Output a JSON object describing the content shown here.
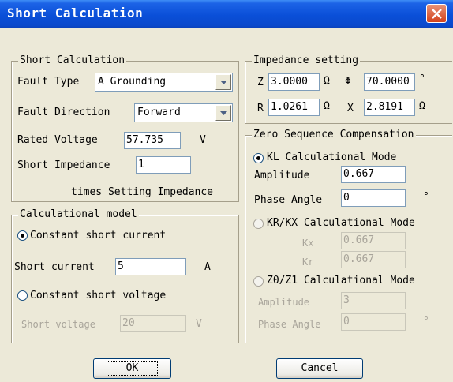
{
  "window": {
    "title": "Short Calculation"
  },
  "short_calc": {
    "group_title": "Short Calculation",
    "fault_type_label": "Fault Type",
    "fault_type_value": "A Grounding",
    "fault_direction_label": "Fault Direction",
    "fault_direction_value": "Forward",
    "rated_voltage_label": "Rated Voltage",
    "rated_voltage_value": "57.735",
    "rated_voltage_unit": "V",
    "short_impedance_label": "Short Impedance",
    "short_impedance_value": "1",
    "times_label": "times Setting Impedance"
  },
  "calc_model": {
    "group_title": "Calculational model",
    "constant_current_label": "Constant short current",
    "constant_current_selected": true,
    "short_current_label": "Short current",
    "short_current_value": "5",
    "short_current_unit": "A",
    "constant_voltage_label": "Constant short voltage",
    "constant_voltage_selected": false,
    "short_voltage_label": "Short voltage",
    "short_voltage_value": "20",
    "short_voltage_unit": "V"
  },
  "impedance": {
    "group_title": "Impedance setting",
    "z_label": "Z",
    "z_value": "3.0000",
    "z_unit": "Ω",
    "phi_label": "Φ",
    "phi_value": "70.0000",
    "phi_unit": "°",
    "r_label": "R",
    "r_value": "1.0261",
    "r_unit": "Ω",
    "x_label": "X",
    "x_value": "2.8191",
    "x_unit": "Ω"
  },
  "zero_seq": {
    "group_title": "Zero Sequence Compensation",
    "kl_mode_label": "KL Calculational Mode",
    "kl_selected": true,
    "amplitude_label": "Amplitude",
    "amplitude_value": "0.667",
    "phase_angle_label": "Phase Angle",
    "phase_angle_value": "0",
    "phase_angle_unit": "°",
    "krkx_mode_label": "KR/KX Calculational Mode",
    "kx_label": "Kx",
    "kx_value": "0.667",
    "kr_label": "Kr",
    "kr_value": "0.667",
    "z0z1_mode_label": "Z0/Z1 Calculational Mode",
    "z0z1_amplitude_label": "Amplitude",
    "z0z1_amplitude_value": "3",
    "z0z1_phase_label": "Phase Angle",
    "z0z1_phase_value": "0",
    "z0z1_phase_unit": "°"
  },
  "buttons": {
    "ok": "OK",
    "cancel": "Cancel"
  }
}
